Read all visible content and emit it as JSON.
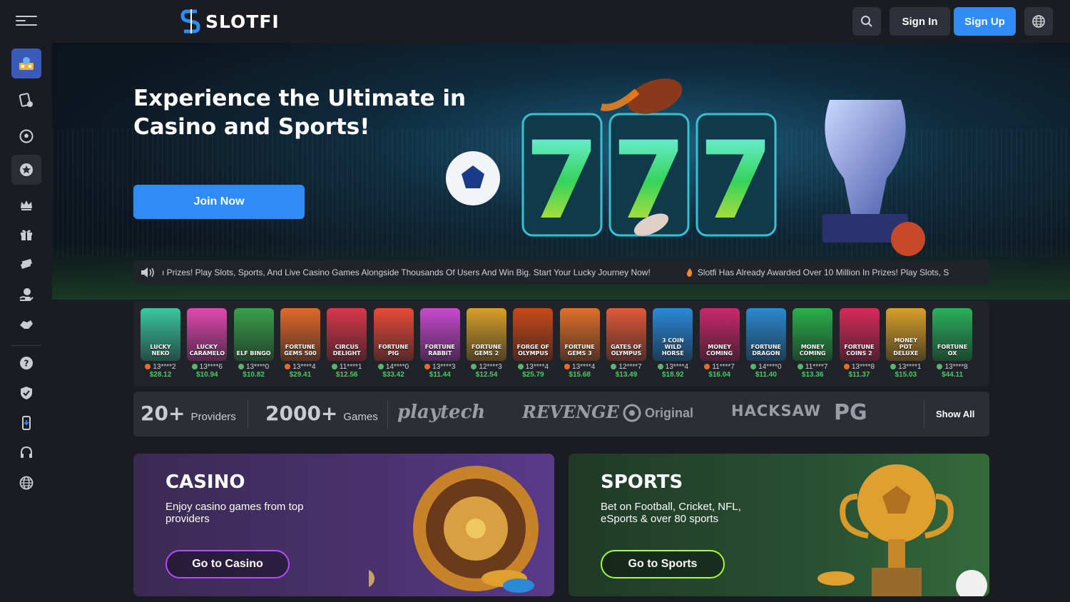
{
  "brand": {
    "name": "SLOTFI",
    "accent": "#2f8cf7"
  },
  "header": {
    "signin_label": "Sign In",
    "signup_label": "Sign Up"
  },
  "sidebar": {
    "items": [
      {
        "icon": "casino-icon",
        "active": true
      },
      {
        "icon": "slots-icon"
      },
      {
        "icon": "soccer-ball-icon"
      },
      {
        "icon": "star-badge-icon"
      },
      {
        "icon": "crown-icon"
      },
      {
        "icon": "gift-icon"
      },
      {
        "icon": "ticket-icon"
      },
      {
        "icon": "money-hand-icon"
      },
      {
        "icon": "handshake-icon"
      },
      {
        "icon": "help-icon"
      },
      {
        "icon": "shield-check-icon"
      },
      {
        "icon": "mobile-app-icon"
      },
      {
        "icon": "headset-icon"
      },
      {
        "icon": "globe-icon"
      }
    ]
  },
  "hero": {
    "title": "Experience the Ultimate in Casino and Sports!",
    "join_label": "Join Now"
  },
  "ticker": {
    "text1": "ı Prizes! Play Slots, Sports, And Live Casino Games Alongside Thousands Of Users And Win Big. Start Your Lucky Journey Now!",
    "text2": "Slotfi Has Already Awarded Over 10 Million In Prizes! Play Slots, S"
  },
  "games": [
    {
      "name": "Lucky Neko",
      "user": "13****2",
      "amount": "$28.12",
      "color": "#3cc7a0"
    },
    {
      "name": "Lucky Caramelo",
      "user": "13****6",
      "amount": "$10.94",
      "color": "#e04ab0"
    },
    {
      "name": "Elf Bingo",
      "user": "13****0",
      "amount": "$10.82",
      "color": "#3aa04a"
    },
    {
      "name": "Fortune Gems 500",
      "user": "13****4",
      "amount": "$29.41",
      "color": "#e06a2a"
    },
    {
      "name": "Circus Delight",
      "user": "11****1",
      "amount": "$12.56",
      "color": "#d8384a"
    },
    {
      "name": "Fortune Pig",
      "user": "14****0",
      "amount": "$33.42",
      "color": "#e84a3a"
    },
    {
      "name": "Fortune Rabbit",
      "user": "13****3",
      "amount": "$11.44",
      "color": "#c84ad0"
    },
    {
      "name": "Fortune Gems 2",
      "user": "12****3",
      "amount": "$12.54",
      "color": "#d8a02a"
    },
    {
      "name": "Forge of Olympus",
      "user": "13****4",
      "amount": "$25.79",
      "color": "#c84a1a"
    },
    {
      "name": "Fortune Gems 3",
      "user": "13****4",
      "amount": "$15.68",
      "color": "#e0702a"
    },
    {
      "name": "Gates of Olympus",
      "user": "12****7",
      "amount": "$13.49",
      "color": "#e05a3a"
    },
    {
      "name": "3 Coin Wild Horse",
      "user": "13****4",
      "amount": "$18.92",
      "color": "#2a8ad8"
    },
    {
      "name": "Money Coming",
      "user": "11****7",
      "amount": "$16.04",
      "color": "#c82a6a"
    },
    {
      "name": "Fortune Dragon",
      "user": "14****0",
      "amount": "$11.40",
      "color": "#2a8ad0"
    },
    {
      "name": "Money Coming",
      "user": "11****7",
      "amount": "$13.36",
      "color": "#2ab04a"
    },
    {
      "name": "Fortune Coins 2",
      "user": "13****8",
      "amount": "$11.37",
      "color": "#d82a5a"
    },
    {
      "name": "Money Pot Deluxe",
      "user": "13****1",
      "amount": "$15.03",
      "color": "#d8a02a"
    },
    {
      "name": "Fortune Ox",
      "user": "13****8",
      "amount": "$44.11",
      "color": "#2ab05a"
    }
  ],
  "providers": {
    "providers_count": "20+",
    "providers_label": "Providers",
    "games_count": "2000+",
    "games_label": "Games",
    "names": [
      "playtech",
      "REVENGE",
      "Original",
      "HACKSAW",
      "PG"
    ],
    "show_all_label": "Show All"
  },
  "casino_card": {
    "title": "CASINO",
    "desc": "Enjoy casino games from top providers",
    "button": "Go to Casino"
  },
  "sports_card": {
    "title": "SPORTS",
    "desc": "Bet on Football, Cricket, NFL, eSports & over 80 sports",
    "button": "Go to Sports"
  }
}
